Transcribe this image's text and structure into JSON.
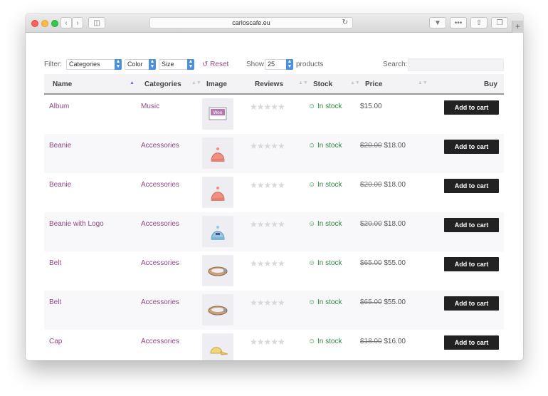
{
  "browser": {
    "url": "carloscafe.eu"
  },
  "filters": {
    "label": "Filter:",
    "categories": "Categories",
    "color": "Color",
    "size": "Size",
    "reset": "Reset",
    "show_label": "Show",
    "show_value": "25",
    "products_label": "products",
    "search_label": "Search:",
    "search_value": ""
  },
  "table": {
    "headers": {
      "name": "Name",
      "categories": "Categories",
      "image": "Image",
      "reviews": "Reviews",
      "stock": "Stock",
      "price": "Price",
      "buy": "Buy"
    },
    "rows": [
      {
        "name": "Album",
        "category": "Music",
        "image_icon": "album-icon",
        "rating": "★★★★★",
        "stock": "In stock",
        "old_price": "",
        "price": "$15.00",
        "button": "Add to cart"
      },
      {
        "name": "Beanie",
        "category": "Accessories",
        "image_icon": "beanie-icon",
        "rating": "★★★★★",
        "stock": "In stock",
        "old_price": "$20.00",
        "price": "$18.00",
        "button": "Add to cart"
      },
      {
        "name": "Beanie",
        "category": "Accessories",
        "image_icon": "beanie-icon",
        "rating": "★★★★★",
        "stock": "In stock",
        "old_price": "$20.00",
        "price": "$18.00",
        "button": "Add to cart"
      },
      {
        "name": "Beanie with Logo",
        "category": "Accessories",
        "image_icon": "beanie-logo-icon",
        "rating": "★★★★★",
        "stock": "In stock",
        "old_price": "$20.00",
        "price": "$18.00",
        "button": "Add to cart"
      },
      {
        "name": "Belt",
        "category": "Accessories",
        "image_icon": "belt-icon",
        "rating": "★★★★★",
        "stock": "In stock",
        "old_price": "$65.00",
        "price": "$55.00",
        "button": "Add to cart"
      },
      {
        "name": "Belt",
        "category": "Accessories",
        "image_icon": "belt-icon",
        "rating": "★★★★★",
        "stock": "In stock",
        "old_price": "$65.00",
        "price": "$55.00",
        "button": "Add to cart"
      },
      {
        "name": "Cap",
        "category": "Accessories",
        "image_icon": "cap-icon",
        "rating": "★★★★★",
        "stock": "In stock",
        "old_price": "$18.00",
        "price": "$16.00",
        "button": "Add to cart"
      }
    ]
  }
}
